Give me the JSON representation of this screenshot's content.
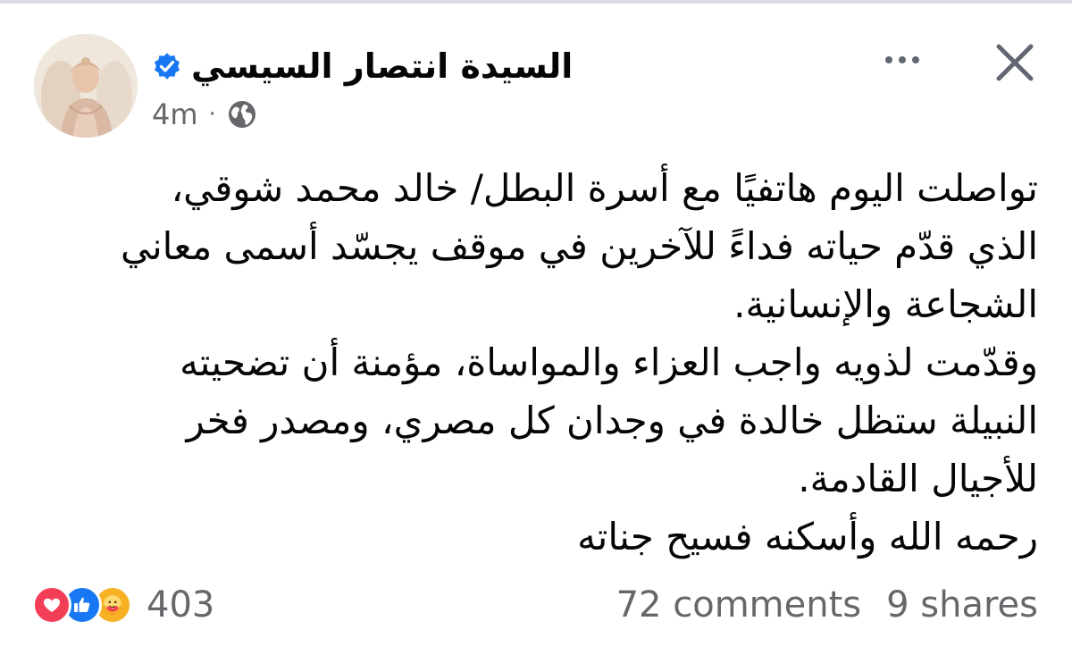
{
  "post": {
    "author": {
      "name": "السيدة  انتصار السيسي",
      "verified": true
    },
    "timestamp": "4m",
    "separator": "·",
    "audience_icon": "globe-icon",
    "body_lines": [
      "تواصلت اليوم هاتفيًا مع أسرة البطل/ خالد محمد شوقي،",
      "الذي قدّم حياته فداءً للآخرين في موقف يجسّد أسمى معاني",
      "الشجاعة والإنسانية.",
      "وقدّمت لذويه واجب العزاء والمواساة، مؤمنة أن تضحيته",
      "النبيلة ستظل خالدة في وجدان كل مصري، ومصدر فخر",
      "للأجيال القادمة.",
      "رحمه الله وأسكنه فسيح جناته"
    ],
    "reactions": {
      "icons": [
        "love-icon",
        "like-icon",
        "care-icon"
      ],
      "count": "403"
    },
    "comments": "72 comments",
    "shares": "9 shares"
  },
  "colors": {
    "verified_blue": "#1877f2",
    "secondary_text": "#65676b",
    "love_red": "#f33e58",
    "care_yellow": "#f7b125"
  }
}
